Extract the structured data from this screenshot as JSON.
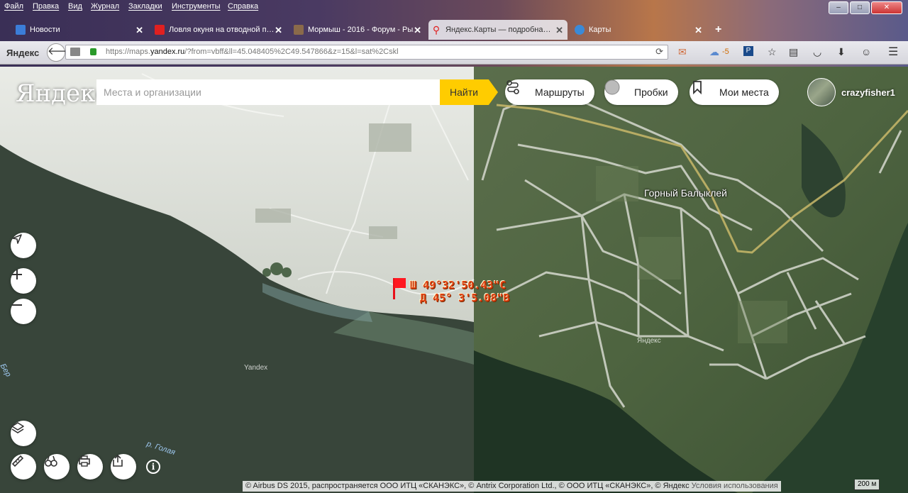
{
  "browser": {
    "menu": [
      "Файл",
      "Правка",
      "Вид",
      "Журнал",
      "Закладки",
      "Инструменты",
      "Справка"
    ],
    "window_buttons": [
      "–",
      "□",
      "✕"
    ],
    "tabs": [
      {
        "title": "Новости",
        "icon": "play-icon",
        "color": "#3b7dd8",
        "active": false
      },
      {
        "title": "Ловля окуня на отводной п…",
        "icon": "youtube-icon",
        "color": "#e02020",
        "active": false
      },
      {
        "title": "Мормыш - 2016 - Форум - Ры…",
        "icon": "forum-icon",
        "color": "#8a6a4a",
        "active": false
      },
      {
        "title": "Яндекс.Карты — подробна…",
        "icon": "pin-icon",
        "color": "#e02020",
        "active": true
      },
      {
        "title": "Карты",
        "icon": "globe-icon",
        "color": "#3a8ad8",
        "active": false
      }
    ],
    "new_tab_label": "+",
    "brand": "Яндекс",
    "url_prefix": "https://maps.",
    "url_host": "yandex.ru",
    "url_rest": "/?from=vbff&ll=45.048405%2C49.547866&z=15&l=sat%2Cskl",
    "weather": "-5"
  },
  "map": {
    "logo": "Яндекс",
    "search_placeholder": "Места и организации",
    "search_button": "Найти",
    "routes_label": "Маршруты",
    "traffic_label": "Пробки",
    "places_label": "Мои места",
    "username": "crazyfisher1",
    "place_label": "Горный Балыклей",
    "watermark_left": "Yandex",
    "watermark_right": "Яндекс",
    "river_label": "р. Голая",
    "edge_label_left": "Бер",
    "coord_line1": "Ш 49°32'50.43\"С",
    "coord_line2": "Д 45° 3'5.08\"В",
    "attribution": "© Airbus DS 2015, распространяется ООО ИТЦ «СКАНЭКС», © Antrix Corporation Ltd., © ООО ИТЦ «СКАНЭКС», © Яндекс",
    "terms_link": "Условия использования",
    "scale_label": "200 м"
  }
}
